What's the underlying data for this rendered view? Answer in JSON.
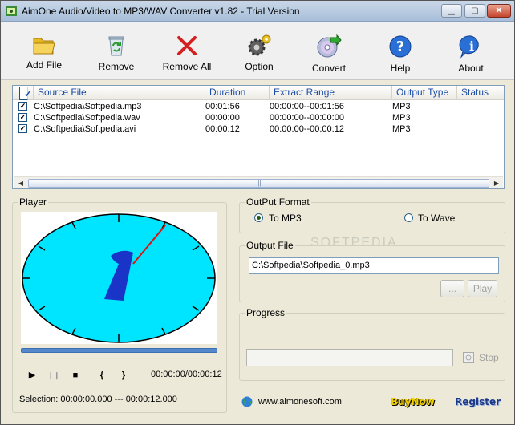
{
  "window": {
    "title": "AimOne Audio/Video to MP3/WAV Converter v1.82 - Trial Version"
  },
  "toolbar": {
    "add_file": "Add File",
    "remove": "Remove",
    "remove_all": "Remove All",
    "option": "Option",
    "convert": "Convert",
    "help": "Help",
    "about": "About"
  },
  "file_list": {
    "columns": {
      "source": "Source File",
      "duration": "Duration",
      "range": "Extract Range",
      "type": "Output Type",
      "status": "Status"
    },
    "rows": [
      {
        "source": "C:\\Softpedia\\Softpedia.mp3",
        "duration": "00:01:56",
        "range": "00:00:00--00:01:56",
        "type": "MP3"
      },
      {
        "source": "C:\\Softpedia\\Softpedia.wav",
        "duration": "00:00:00",
        "range": "00:00:00--00:00:00",
        "type": "MP3"
      },
      {
        "source": "C:\\Softpedia\\Softpedia.avi",
        "duration": "00:00:12",
        "range": "00:00:00--00:00:12",
        "type": "MP3"
      }
    ],
    "scroll_grip": "|||"
  },
  "player": {
    "label": "Player",
    "time": "00:00:00/00:00:12",
    "selection": "Selection: 00:00:00.000 --- 00:00:12.000",
    "play_glyph": "▶",
    "pause_glyph": "❙❙",
    "stop_glyph": "■",
    "mark_in": "{",
    "mark_out": "}"
  },
  "output_format": {
    "label": "OutPut Format",
    "mp3": "To MP3",
    "wave": "To Wave",
    "selected": "mp3"
  },
  "output_file": {
    "label": "Output File",
    "value": "C:\\Softpedia\\Softpedia_0.mp3",
    "browse": "...",
    "play": "Play"
  },
  "progress": {
    "label": "Progress",
    "stop": "Stop"
  },
  "footer": {
    "website": "www.aimonesoft.com",
    "buy": "BuyNow",
    "register": "Register"
  },
  "watermark": "SOFTPEDIA",
  "colors": {
    "clock_face": "#00e5ff",
    "hand": "#1a34c8",
    "second_hand": "#e01010",
    "buy": "#f0d000",
    "register": "#1d3a8a"
  }
}
